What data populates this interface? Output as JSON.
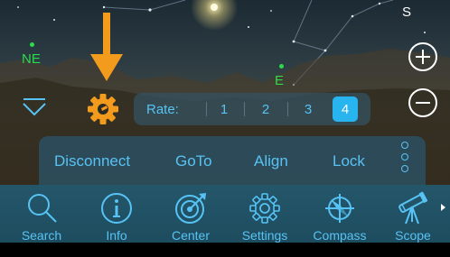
{
  "compass": {
    "ne": "NE",
    "e": "E"
  },
  "sky_corner_letter": "S",
  "colors": {
    "accent_blue": "#57c3f4",
    "active_rate": "#27b4ef",
    "compass_green": "#2bdc4a",
    "arrow_orange": "#f39b1d",
    "toolbar_bg": "#24566a"
  },
  "rate": {
    "label": "Rate:",
    "options": [
      "1",
      "2",
      "3",
      "4"
    ],
    "selected": "4"
  },
  "commands": [
    "Disconnect",
    "GoTo",
    "Align",
    "Lock"
  ],
  "toolbar": [
    {
      "label": "Search",
      "icon": "search-icon"
    },
    {
      "label": "Info",
      "icon": "info-icon"
    },
    {
      "label": "Center",
      "icon": "target-icon"
    },
    {
      "label": "Settings",
      "icon": "gear-icon"
    },
    {
      "label": "Compass",
      "icon": "compass-icon"
    },
    {
      "label": "Scope",
      "icon": "telescope-icon"
    }
  ]
}
